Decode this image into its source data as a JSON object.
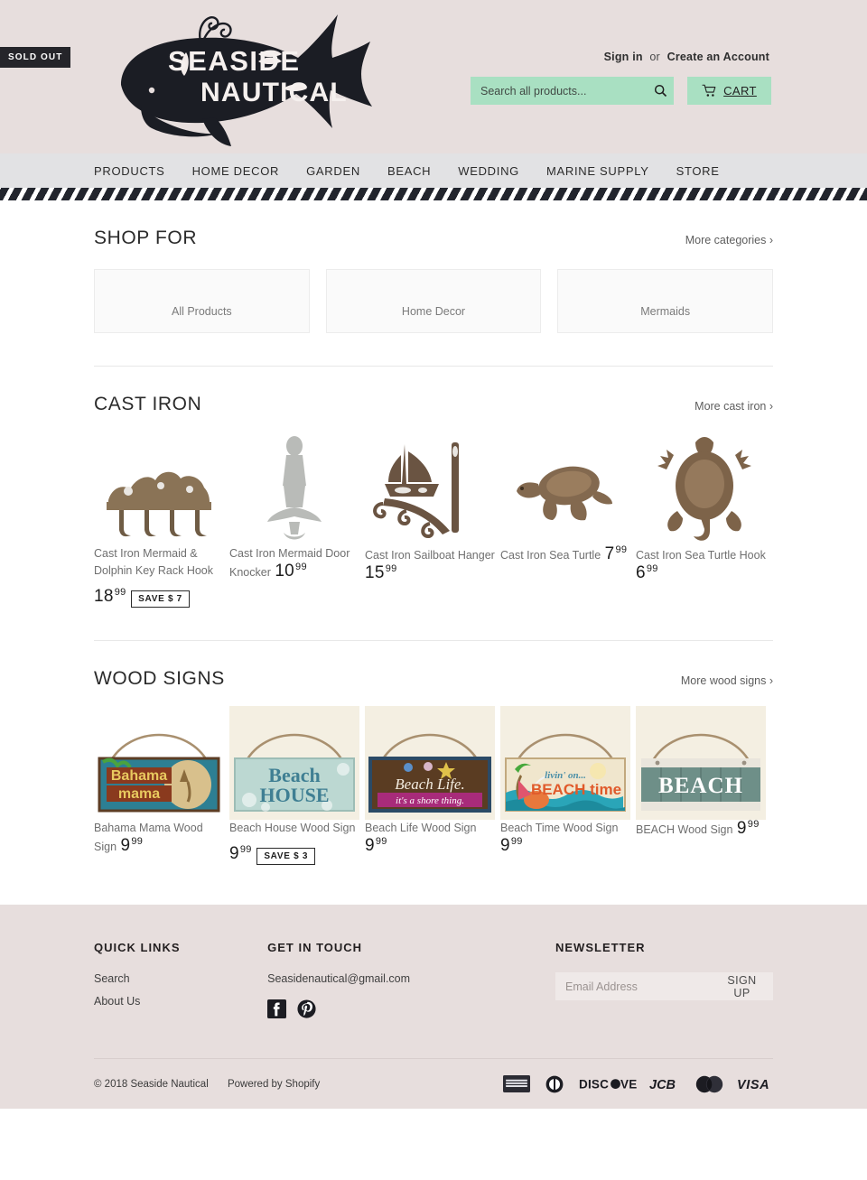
{
  "header": {
    "logo_line1": "SEASIDE",
    "logo_line2": "NAUTICAL",
    "logo_icon": "whale-logo",
    "sign_in": "Sign in",
    "or": "or",
    "create_account": "Create an Account",
    "search_placeholder": "Search all products...",
    "search_value": "",
    "search_icon": "search-icon",
    "cart_label": "CART",
    "cart_icon": "shopping-cart-icon",
    "accent_mint": "#a9e0c2",
    "bg": "#e7dedd"
  },
  "nav": {
    "items": [
      {
        "label": "PRODUCTS"
      },
      {
        "label": "HOME DECOR"
      },
      {
        "label": "GARDEN"
      },
      {
        "label": "BEACH"
      },
      {
        "label": "WEDDING"
      },
      {
        "label": "MARINE SUPPLY"
      },
      {
        "label": "STORE"
      }
    ]
  },
  "shop_for": {
    "title": "SHOP FOR",
    "more": "More categories ›",
    "cards": [
      {
        "label": "All Products"
      },
      {
        "label": "Home Decor"
      },
      {
        "label": "Mermaids"
      }
    ]
  },
  "cast_iron": {
    "title": "CAST IRON",
    "more": "More cast iron ›",
    "products": [
      {
        "title": "Cast Iron Mermaid & Dolphin Key Rack Hook",
        "price_dollars": "18",
        "price_cents": "99",
        "badge": "SAVE $ 7",
        "sold_out": "",
        "image": "cast-iron-mermaid-dolphin-key-rack"
      },
      {
        "title": "Cast Iron Mermaid Door Knocker",
        "price_dollars": "10",
        "price_cents": "99",
        "badge": "",
        "sold_out": "SOLD OUT",
        "image": "cast-iron-mermaid-door-knocker"
      },
      {
        "title": "Cast Iron Sailboat Hanger",
        "price_dollars": "15",
        "price_cents": "99",
        "badge": "",
        "sold_out": "",
        "image": "cast-iron-sailboat-hanger"
      },
      {
        "title": "Cast Iron Sea Turtle",
        "price_dollars": "7",
        "price_cents": "99",
        "badge": "",
        "sold_out": "",
        "image": "cast-iron-sea-turtle"
      },
      {
        "title": "Cast Iron Sea Turtle Hook",
        "price_dollars": "6",
        "price_cents": "99",
        "badge": "",
        "sold_out": "",
        "image": "cast-iron-sea-turtle-hook"
      }
    ]
  },
  "wood_signs": {
    "title": "WOOD SIGNS",
    "more": "More wood signs ›",
    "products": [
      {
        "title": "Bahama Mama Wood Sign",
        "price_dollars": "9",
        "price_cents": "99",
        "badge": "",
        "sign_text_1": "Bahama",
        "sign_text_2": "mama",
        "image": "bahama-mama-wood-sign"
      },
      {
        "title": "Beach House Wood Sign",
        "price_dollars": "9",
        "price_cents": "99",
        "badge": "SAVE $ 3",
        "sign_text_1": "Beach",
        "sign_text_2": "HOUSE",
        "image": "beach-house-wood-sign"
      },
      {
        "title": "Beach Life Wood Sign",
        "price_dollars": "9",
        "price_cents": "99",
        "badge": "",
        "sign_text_1": "Beach Life.",
        "sign_text_2": "it's a shore thing.",
        "image": "beach-life-wood-sign"
      },
      {
        "title": "Beach Time Wood Sign",
        "price_dollars": "9",
        "price_cents": "99",
        "badge": "",
        "sign_text_1": "livin' on...",
        "sign_text_2": "BEACH time",
        "image": "beach-time-wood-sign"
      },
      {
        "title": "BEACH Wood Sign",
        "price_dollars": "9",
        "price_cents": "99",
        "badge": "",
        "sign_text_1": "BEACH",
        "sign_text_2": "",
        "image": "beach-wood-sign"
      }
    ]
  },
  "footer": {
    "quick_links_head": "QUICK LINKS",
    "quick_links": [
      {
        "label": "Search"
      },
      {
        "label": "About Us"
      }
    ],
    "get_in_touch_head": "GET IN TOUCH",
    "email": "Seasidenautical@gmail.com",
    "social": [
      {
        "name": "facebook-icon"
      },
      {
        "name": "pinterest-icon"
      }
    ],
    "newsletter_head": "NEWSLETTER",
    "newsletter_placeholder": "Email Address",
    "newsletter_value": "",
    "signup_label": "SIGN UP",
    "copyright": "© 2018 Seaside Nautical",
    "powered_by": "Powered by Shopify",
    "payments": [
      {
        "name": "american-express"
      },
      {
        "name": "diners-club"
      },
      {
        "name": "discover"
      },
      {
        "name": "jcb"
      },
      {
        "name": "mastercard"
      },
      {
        "name": "visa"
      }
    ]
  }
}
